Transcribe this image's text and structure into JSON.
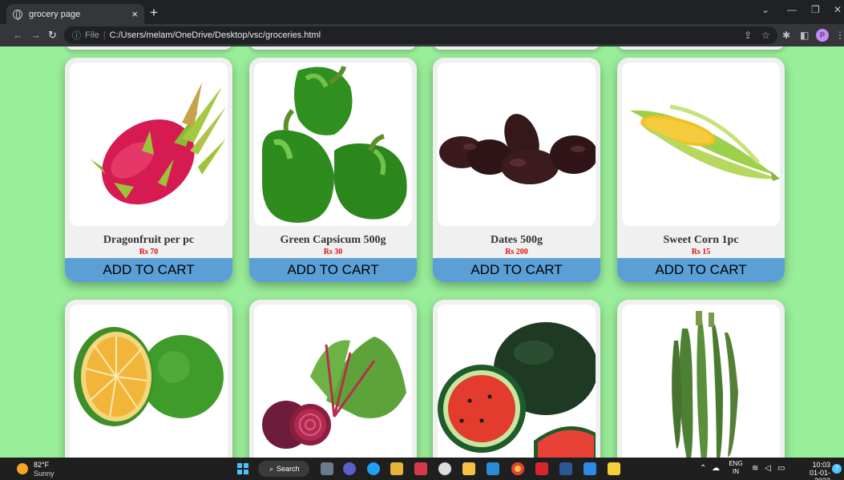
{
  "browser": {
    "tab_title": "grocery page",
    "tab_close": "×",
    "new_tab": "+",
    "url_scheme": "File",
    "url_path": "C:/Users/melam/OneDrive/Desktop/vsc/groceries.html"
  },
  "products_row1": [
    {
      "name": "Dragonfruit per pc",
      "price": "Rs 70",
      "button": "ADD TO CART",
      "icon": "dragonfruit-image"
    },
    {
      "name": "Green Capsicum 500g",
      "price": "Rs 30",
      "button": "ADD TO CART",
      "icon": "capsicum-image"
    },
    {
      "name": "Dates 500g",
      "price": "Rs 200",
      "button": "ADD TO CART",
      "icon": "dates-image"
    },
    {
      "name": "Sweet Corn 1pc",
      "price": "Rs 15",
      "button": "ADD TO CART",
      "icon": "corn-image"
    }
  ],
  "products_row2": [
    {
      "icon": "lime-image"
    },
    {
      "icon": "beetroot-image"
    },
    {
      "icon": "watermelon-image"
    },
    {
      "icon": "okra-image"
    }
  ],
  "taskbar": {
    "weather_temp": "82°F",
    "weather_desc": "Sunny",
    "search_label": "Search",
    "lang_top": "ENG",
    "lang_bottom": "IN",
    "time": "10:03",
    "date": "01-01-2023"
  },
  "colors": {
    "page_bg": "#99ee99",
    "cart_button": "#5aa0d6",
    "price_text": "#e01010"
  }
}
